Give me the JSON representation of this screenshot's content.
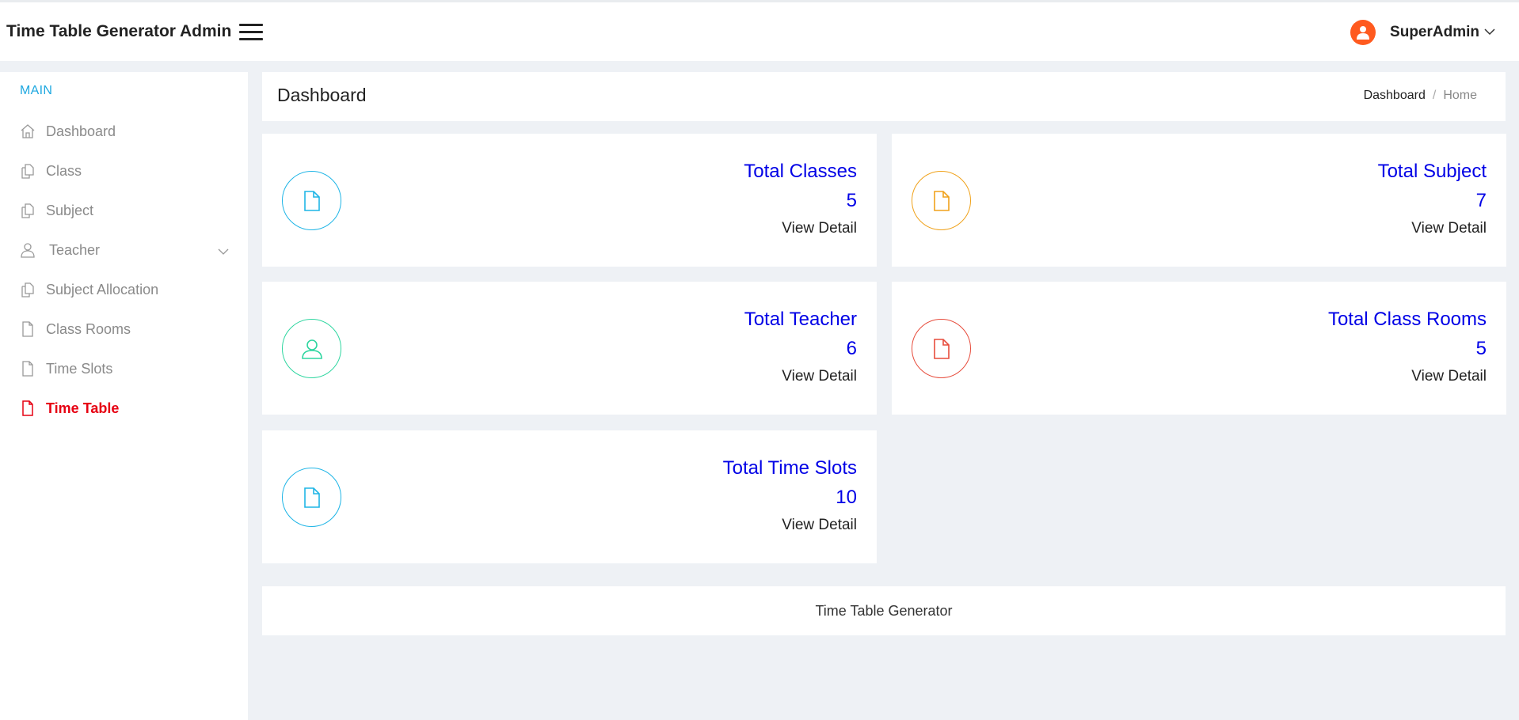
{
  "header": {
    "brand": "Time Table Generator Admin",
    "menu_icon": "hamburger-icon",
    "user_icon": "user-icon",
    "user_name": "SuperAdmin"
  },
  "sidebar": {
    "section": "MAIN",
    "items": [
      {
        "label": "Dashboard",
        "icon": "home-icon"
      },
      {
        "label": "Class",
        "icon": "copy-icon"
      },
      {
        "label": "Subject",
        "icon": "copy-icon"
      },
      {
        "label": "Teacher",
        "icon": "user-icon"
      },
      {
        "label": "Subject Allocation",
        "icon": "copy-icon"
      },
      {
        "label": "Class Rooms",
        "icon": "file-icon"
      },
      {
        "label": "Time Slots",
        "icon": "file-icon"
      },
      {
        "label": "Time Table",
        "icon": "file-icon",
        "active": true
      }
    ]
  },
  "page": {
    "title": "Dashboard",
    "breadcrumb": [
      "Dashboard",
      "Home"
    ]
  },
  "cards": [
    {
      "title": "Total Classes",
      "value": "5",
      "link": "View Detail",
      "icon": "file-icon",
      "color": "#1fb5e6"
    },
    {
      "title": "Total Subject",
      "value": "7",
      "link": "View Detail",
      "icon": "file-icon",
      "color": "#f0a21b"
    },
    {
      "title": "Total Teacher",
      "value": "6",
      "link": "View Detail",
      "icon": "user-icon",
      "color": "#2fd6a0"
    },
    {
      "title": "Total Class Rooms",
      "value": "5",
      "link": "View Detail",
      "icon": "file-icon",
      "color": "#e74c3c"
    },
    {
      "title": "Total Time Slots",
      "value": "10",
      "link": "View Detail",
      "icon": "file-icon",
      "color": "#1fb5e6"
    }
  ],
  "footer": {
    "text": "Time Table Generator"
  },
  "colors": {
    "accent": "#1fa8e0",
    "active": "#e60012",
    "card_text": "#0000e6"
  }
}
